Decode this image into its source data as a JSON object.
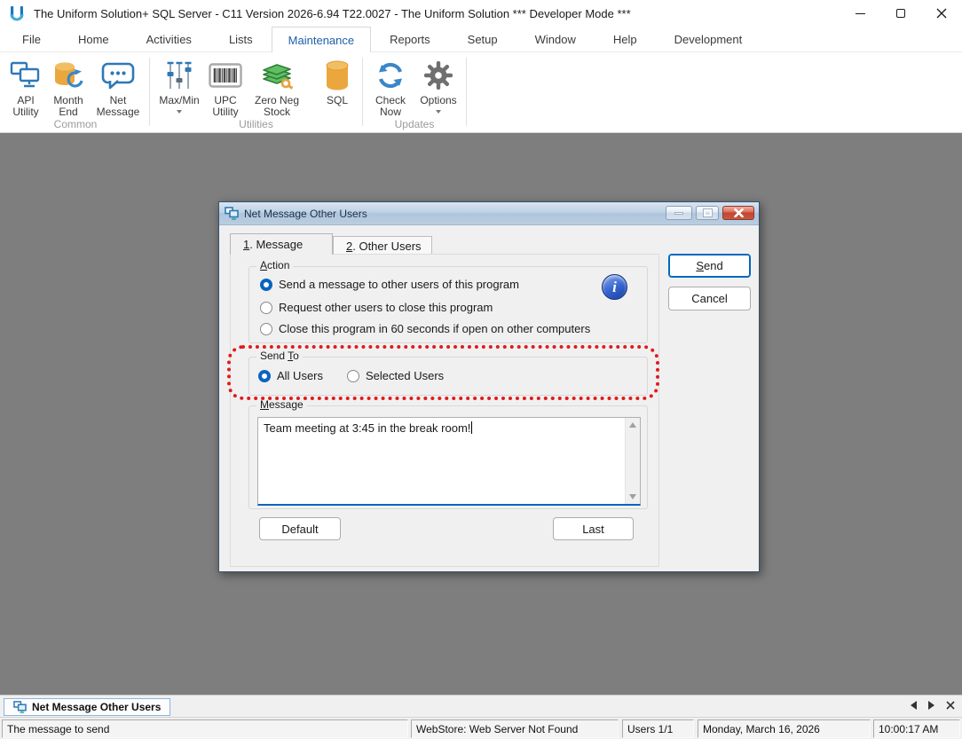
{
  "window": {
    "title": "The Uniform Solution+ SQL Server - C11 Version 2026-6.94 T22.0027 - The Uniform Solution *** Developer Mode ***"
  },
  "menu": {
    "items": [
      "File",
      "Home",
      "Activities",
      "Lists",
      "Maintenance",
      "Reports",
      "Setup",
      "Window",
      "Help",
      "Development"
    ],
    "active": "Maintenance"
  },
  "ribbon": {
    "groups": [
      {
        "label": "Common",
        "items": [
          {
            "label": "API\nUtility",
            "icon": "api-utility-icon"
          },
          {
            "label": "Month\nEnd",
            "icon": "month-end-icon"
          },
          {
            "label": "Net\nMessage",
            "icon": "net-message-icon"
          }
        ]
      },
      {
        "label": "Utilities",
        "items": [
          {
            "label": "Max/Min",
            "icon": "max-min-icon",
            "dropdown": true
          },
          {
            "label": "UPC\nUtility",
            "icon": "upc-utility-icon"
          },
          {
            "label": "Zero Neg\nStock",
            "icon": "zero-neg-stock-icon"
          },
          {
            "label": "SQL",
            "icon": "sql-icon"
          }
        ]
      },
      {
        "label": "Updates",
        "items": [
          {
            "label": "Check\nNow",
            "icon": "check-now-icon"
          },
          {
            "label": "Options",
            "icon": "options-icon",
            "dropdown": true
          }
        ]
      }
    ]
  },
  "dialog": {
    "title": "Net Message Other Users",
    "tabs": [
      {
        "key": "1",
        "rest": ". Message"
      },
      {
        "key": "2",
        "rest": ". Other Users"
      }
    ],
    "action": {
      "legend_key": "A",
      "legend_rest": "ction",
      "options": [
        "Send a message to other users of this program",
        "Request other users to close this program",
        "Close this program in 60 seconds if open on other computers"
      ],
      "selected_index": 0,
      "info_glyph": "i"
    },
    "send_to": {
      "legend_pre": "Send ",
      "legend_key": "T",
      "legend_rest": "o",
      "options": [
        "All Users",
        "Selected Users"
      ],
      "selected_index": 0
    },
    "message": {
      "legend_key": "M",
      "legend_rest": "essage",
      "text": "Team meeting at 3:45 in the break room!"
    },
    "buttons": {
      "send_key": "S",
      "send_rest": "end",
      "cancel": "Cancel",
      "default": "Default",
      "last": "Last"
    }
  },
  "taskbar": {
    "active_tab": "Net Message Other Users"
  },
  "statusbar": {
    "panels": [
      "The message to send",
      "WebStore: Web Server Not Found",
      "Users 1/1",
      "Monday, March 16, 2026",
      "10:00:17 AM"
    ]
  },
  "colors": {
    "accent_blue": "#0067C0",
    "ribbon_icon_blue": "#2E78B8",
    "annotation_red": "#E21A1A",
    "workspace_gray": "#7E7E7E",
    "selected_radio_blue": "#0A64C0"
  }
}
